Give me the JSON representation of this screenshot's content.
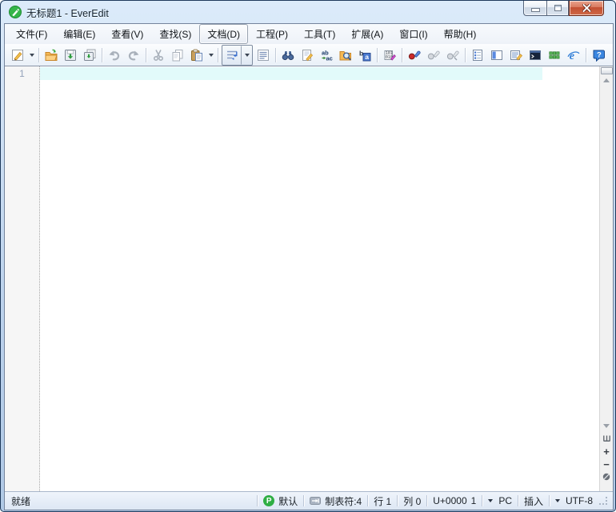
{
  "window": {
    "title": "无标题1 - EverEdit",
    "app_icon": "everedit-green-pencil"
  },
  "menu": {
    "items": [
      "文件(F)",
      "编辑(E)",
      "查看(V)",
      "查找(S)",
      "文档(D)",
      "工程(P)",
      "工具(T)",
      "扩展(A)",
      "窗口(I)",
      "帮助(H)"
    ],
    "active_item": "文档(D)"
  },
  "toolbar": {
    "button_names": [
      "new-file",
      "new-file-dropdown",
      "open-file",
      "save-file",
      "save-all",
      "undo",
      "redo",
      "cut",
      "copy",
      "paste",
      "paste-dropdown",
      "word-wrap",
      "word-wrap-dropdown",
      "show-line-breaks",
      "find",
      "replace",
      "replace-next",
      "find-in-files",
      "highlight-word",
      "hex-edit",
      "record-macro",
      "play-macro",
      "run-macro-multi",
      "document-outline",
      "side-panel",
      "column-edit",
      "terminal",
      "color-blocks",
      "browser-preview",
      "help"
    ],
    "disabled_buttons": [
      "undo",
      "redo",
      "cut",
      "copy",
      "play-macro",
      "run-macro-multi"
    ],
    "pressed_buttons": [
      "word-wrap"
    ]
  },
  "editor": {
    "line_numbers": [
      "1"
    ],
    "active_line": 1,
    "active_line_color": "#e2fafa",
    "text": ""
  },
  "scrollbar": {
    "zoom_in": "+",
    "zoom_out": "−"
  },
  "status_bar": {
    "ready": "就绪",
    "syntax_mode": {
      "badge": "P",
      "label": "默认"
    },
    "tab_width": "制表符:4",
    "line": "行 1",
    "column": "列 0",
    "unicode": "U+0000",
    "unicode_index": "1",
    "line_ending": "PC",
    "input_mode": "插入",
    "encoding": "UTF-8"
  },
  "colors": {
    "titlebar": "#c8dcf2",
    "close_button": "#c24f32",
    "accent_blue": "#4a7ad0",
    "active_line": "#e2fafa",
    "status_badge_green": "#2fae44"
  }
}
